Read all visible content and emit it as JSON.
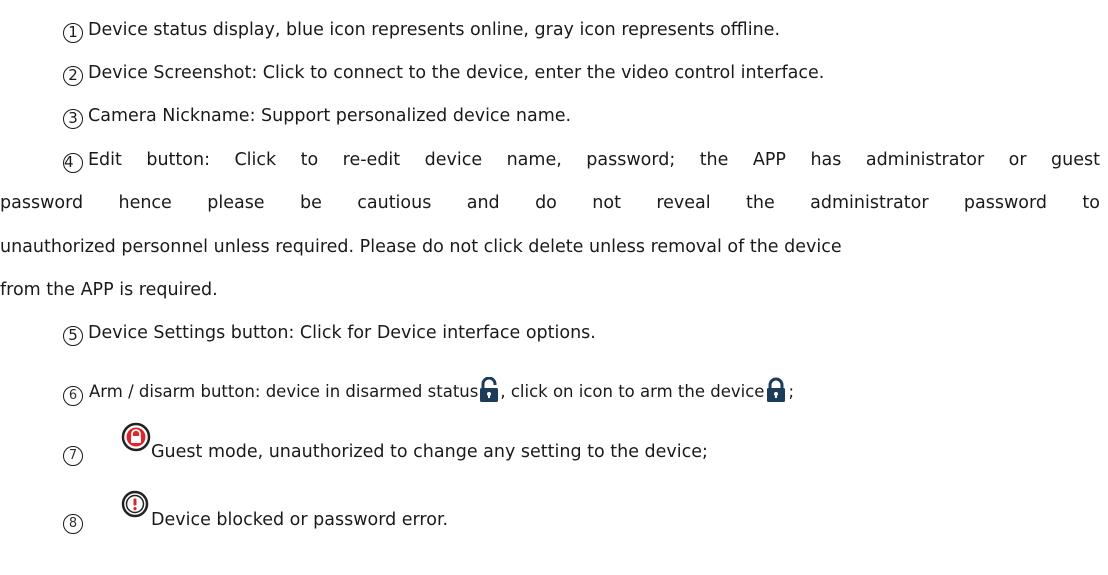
{
  "items": [
    {
      "num": "1",
      "text": "Device status display, blue icon represents online, gray icon represents offline."
    },
    {
      "num": "2",
      "text": "Device Screenshot: Click to connect to the device, enter the video control interface."
    },
    {
      "num": "3",
      "text": "Camera Nickname: Support personalized device name."
    },
    {
      "num": "4",
      "text_line1": "Edit button: Click to re-edit device name, password; the APP has administrator or guest",
      "text_line2": "password hence please be cautious and do not reveal the administrator password to",
      "text_line3": "unauthorized personnel unless required. Please do not click delete unless removal of the device",
      "text_line4": "from the APP is required."
    },
    {
      "num": "5",
      "text": "Device Settings button: Click for Device interface options."
    },
    {
      "num": "6",
      "text_a": "Arm / disarm button: device in disarmed status",
      "text_b": ", click on icon to arm the device",
      "text_c": ";"
    },
    {
      "num": "7",
      "text": "Guest mode, unauthorized to change any setting to the device;"
    },
    {
      "num": "8",
      "text": "Device blocked or password error."
    }
  ],
  "icons": {
    "disarmed": "unlocked-padlock-icon",
    "armed": "locked-padlock-icon",
    "guest": "red-lock-badge-icon",
    "error": "exclamation-badge-icon"
  },
  "colors": {
    "guest_red": "#e0242b",
    "icon_dark": "#3b3b3b",
    "icon_blue_dark": "#1c3d5a"
  }
}
